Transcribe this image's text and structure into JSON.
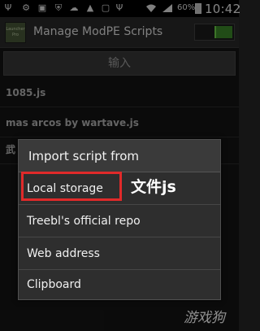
{
  "status_bar": {
    "left_icons": [
      "usb-icon",
      "usb-debug-icon",
      "image-icon",
      "shield-icon",
      "cloud-icon",
      "landscape-icon",
      "tv-icon",
      "usb-icon"
    ],
    "wifi_icon": "wifi-icon",
    "signal_icon": "signal-icon",
    "battery_percent": "60%",
    "time": "10:42"
  },
  "action_bar": {
    "logo_text": "Launcher Pro",
    "title": "Manage ModPE Scripts",
    "toggle_on": true
  },
  "import_button": {
    "label": "输入"
  },
  "scripts": [
    {
      "name": "1085.js"
    },
    {
      "name": "mas arcos by wartave.js"
    },
    {
      "name": "武"
    }
  ],
  "dialog": {
    "title": "Import script from",
    "options": [
      {
        "label": "Local storage"
      },
      {
        "label": "Treebl's official repo"
      },
      {
        "label": "Web address"
      },
      {
        "label": "Clipboard"
      }
    ]
  },
  "annotation": {
    "text": "文件js",
    "color": "#e02a2a"
  },
  "watermark": {
    "text": "游戏狗"
  },
  "colors": {
    "toggle_accent": "#6fd34a",
    "highlight": "#e02a2a"
  }
}
